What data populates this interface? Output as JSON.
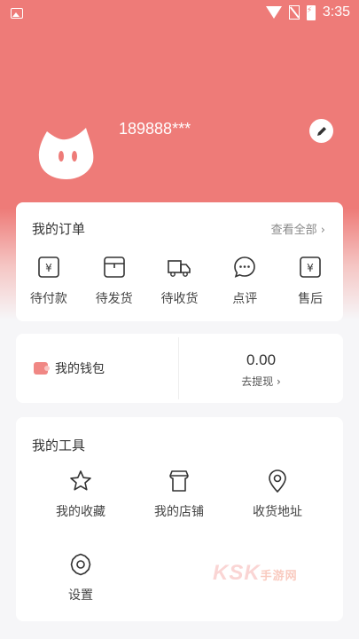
{
  "status_bar": {
    "time": "3:35"
  },
  "profile": {
    "phone": "189888***"
  },
  "orders": {
    "title": "我的订单",
    "view_all": "查看全部 ›",
    "items": [
      {
        "label": "待付款",
        "icon": "yen-bag-icon"
      },
      {
        "label": "待发货",
        "icon": "box-icon"
      },
      {
        "label": "待收货",
        "icon": "truck-icon"
      },
      {
        "label": "点评",
        "icon": "comment-icon"
      },
      {
        "label": "售后",
        "icon": "yen-service-icon"
      }
    ]
  },
  "wallet": {
    "label": "我的钱包",
    "balance": "0.00",
    "withdraw": "去提现 ›"
  },
  "tools": {
    "title": "我的工具",
    "items": [
      {
        "label": "我的收藏",
        "icon": "star-icon"
      },
      {
        "label": "我的店铺",
        "icon": "shop-icon"
      },
      {
        "label": "收货地址",
        "icon": "location-icon"
      },
      {
        "label": "设置",
        "icon": "settings-icon"
      }
    ]
  },
  "watermark": {
    "text": "KSK",
    "sub": "手游网"
  },
  "colors": {
    "header": "#ee7b78",
    "accent": "#f08784",
    "background": "#f6f6f8"
  }
}
